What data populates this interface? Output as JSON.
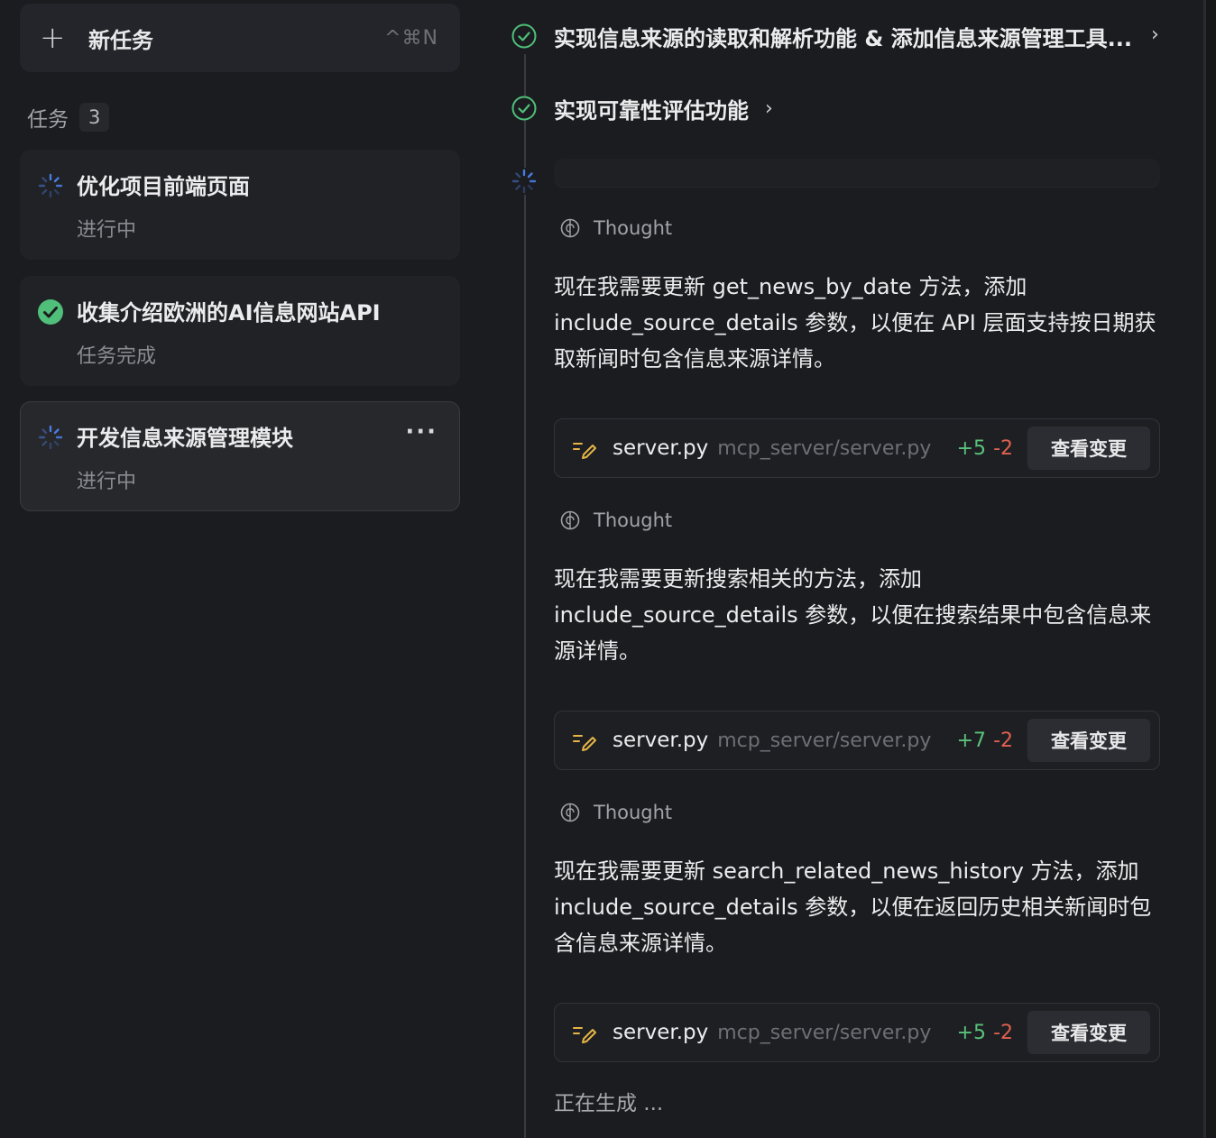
{
  "sidebar": {
    "new_task": {
      "label": "新任务",
      "shortcut": "^⌘N"
    },
    "tasks_title": "任务",
    "tasks_count": "3",
    "tasks": [
      {
        "name": "优化项目前端页面",
        "state": "进行中",
        "status": "in-progress"
      },
      {
        "name": "收集介绍欧洲的AI信息网站API",
        "state": "任务完成",
        "status": "done"
      },
      {
        "name": "开发信息来源管理模块",
        "state": "进行中",
        "status": "in-progress",
        "more": "···"
      }
    ]
  },
  "main": {
    "steps": [
      {
        "text": "实现信息来源的读取和解析功能 & 添加信息来源管理工具...",
        "chevron": "›"
      },
      {
        "text": "实现可靠性评估功能",
        "chevron": "›"
      }
    ],
    "thought_label": "Thought",
    "blocks": [
      {
        "thought": "现在我需要更新 get_news_by_date 方法，添加 include_source_details 参数，以便在 API 层面支持按日期获取新闻时包含信息来源详情。",
        "file": "server.py",
        "path": "mcp_server/server.py",
        "added": "+5",
        "removed": "-2",
        "button": "查看变更"
      },
      {
        "thought": "现在我需要更新搜索相关的方法，添加 include_source_details 参数，以便在搜索结果中包含信息来源详情。",
        "file": "server.py",
        "path": "mcp_server/server.py",
        "added": "+7",
        "removed": "-2",
        "button": "查看变更"
      },
      {
        "thought": "现在我需要更新 search_related_news_history 方法，添加 include_source_details 参数，以便在返回历史相关新闻时包含信息来源详情。",
        "file": "server.py",
        "path": "mcp_server/server.py",
        "added": "+5",
        "removed": "-2",
        "button": "查看变更"
      }
    ],
    "generating": "正在生成 ..."
  },
  "colors": {
    "background": "#1b1c1f",
    "success": "#4fbf7a",
    "spinner": "#4a7be0",
    "added": "#58c27a",
    "removed": "#e0614f",
    "edit_icon": "#e6b545"
  }
}
